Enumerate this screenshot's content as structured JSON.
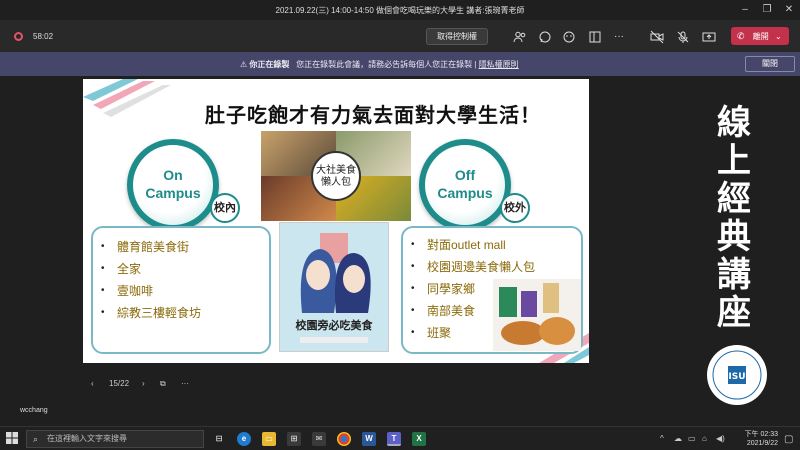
{
  "window": {
    "title": "2021.09.22(三) 14:00-14:50 做個會吃喝玩樂的大學生 講者:張琬菁老師"
  },
  "toolbar": {
    "timer": "58:02",
    "take_control": "取得控制權",
    "leave_label": "離開",
    "recording_color": "#e05566",
    "leave_color": "#c4314b"
  },
  "banner": {
    "bold": "你正在錄製",
    "text": "您正在錄製此會議，請務必告訴每個人您正在錄製",
    "link": "隱私權原則",
    "dismiss": "關閉"
  },
  "slide": {
    "title": "肚子吃飽才有力氣去面對大學生活！",
    "on_campus": {
      "line1": "On",
      "line2": "Campus",
      "tag": "校內"
    },
    "off_campus": {
      "line1": "Off",
      "line2": "Campus",
      "tag": "校外"
    },
    "on_items": [
      "體育館美食街",
      "全家",
      "壹咖啡",
      "綜教三樓輕食坊"
    ],
    "off_items": [
      "對面outlet mall",
      "校園週邊美食懶人包",
      "同學家鄉",
      "南部美食",
      "班聚"
    ],
    "collage_caption": "大社美食懶人包",
    "poster_caption": "校園旁必吃美食",
    "accent_color": "#1e8c8a",
    "item_color": "#8a6a0a"
  },
  "slide_nav": {
    "page": "15/22"
  },
  "side_banner": {
    "chars": [
      "線",
      "上",
      "經",
      "典",
      "講",
      "座"
    ]
  },
  "user_label": "wcchang",
  "taskbar": {
    "search_placeholder": "在這裡輸入文字來搜尋",
    "time": "下午 02:33",
    "date": "2021/9/22"
  }
}
